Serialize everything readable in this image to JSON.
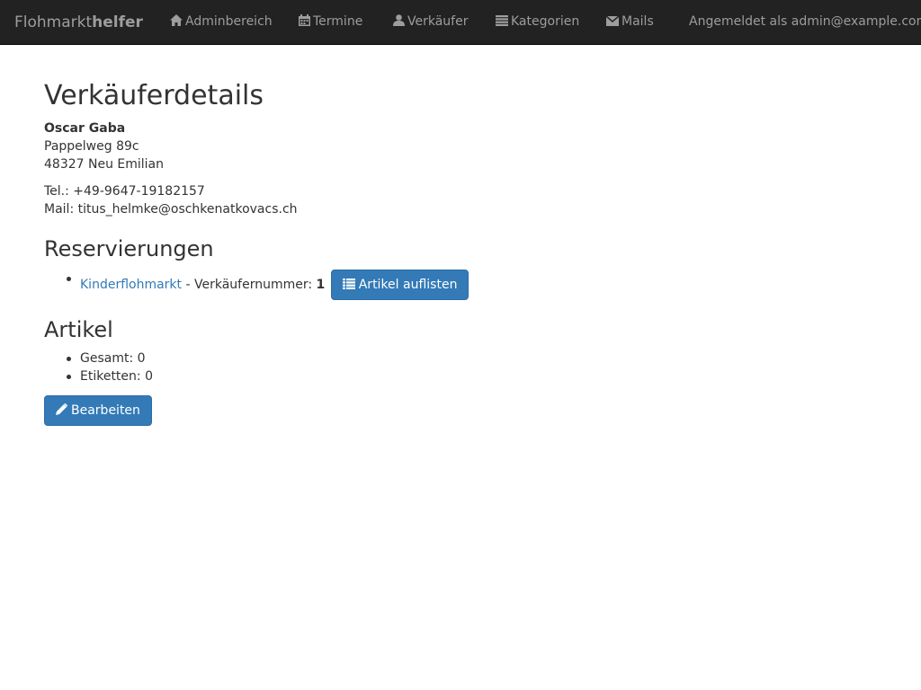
{
  "navbar": {
    "brand_part1": "Flohmarkt",
    "brand_part2": "helfer",
    "items": [
      {
        "label": "Adminbereich",
        "icon": "home-icon"
      },
      {
        "label": "Termine",
        "icon": "calendar-icon"
      },
      {
        "label": "Verkäufer",
        "icon": "user-icon"
      },
      {
        "label": "Kategorien",
        "icon": "list-icon"
      },
      {
        "label": "Mails",
        "icon": "envelope-icon"
      }
    ],
    "user_text": "Angemeldet als admin@example.com"
  },
  "page": {
    "title": "Verkäuferdetails",
    "seller": {
      "name": "Oscar Gaba",
      "street": "Pappelweg 89c",
      "city": "48327 Neu Emilian",
      "phone": "Tel.: +49-9647-19182157",
      "mail": "Mail: titus_helmke@oschkenatkovacs.ch"
    },
    "reservations": {
      "heading": "Reservierungen",
      "items": [
        {
          "market": "Kinderflohmarkt",
          "separator": " - Verkäufernummer: ",
          "number": "1",
          "button_label": "Artikel auflisten"
        }
      ]
    },
    "articles": {
      "heading": "Artikel",
      "total": "Gesamt: 0",
      "labels": "Etiketten: 0"
    },
    "edit_button": "Bearbeiten"
  },
  "colors": {
    "navbar_bg": "#222222",
    "navbar_text": "#9d9d9d",
    "primary": "#337ab7",
    "link": "#337ab7",
    "text": "#333333"
  }
}
